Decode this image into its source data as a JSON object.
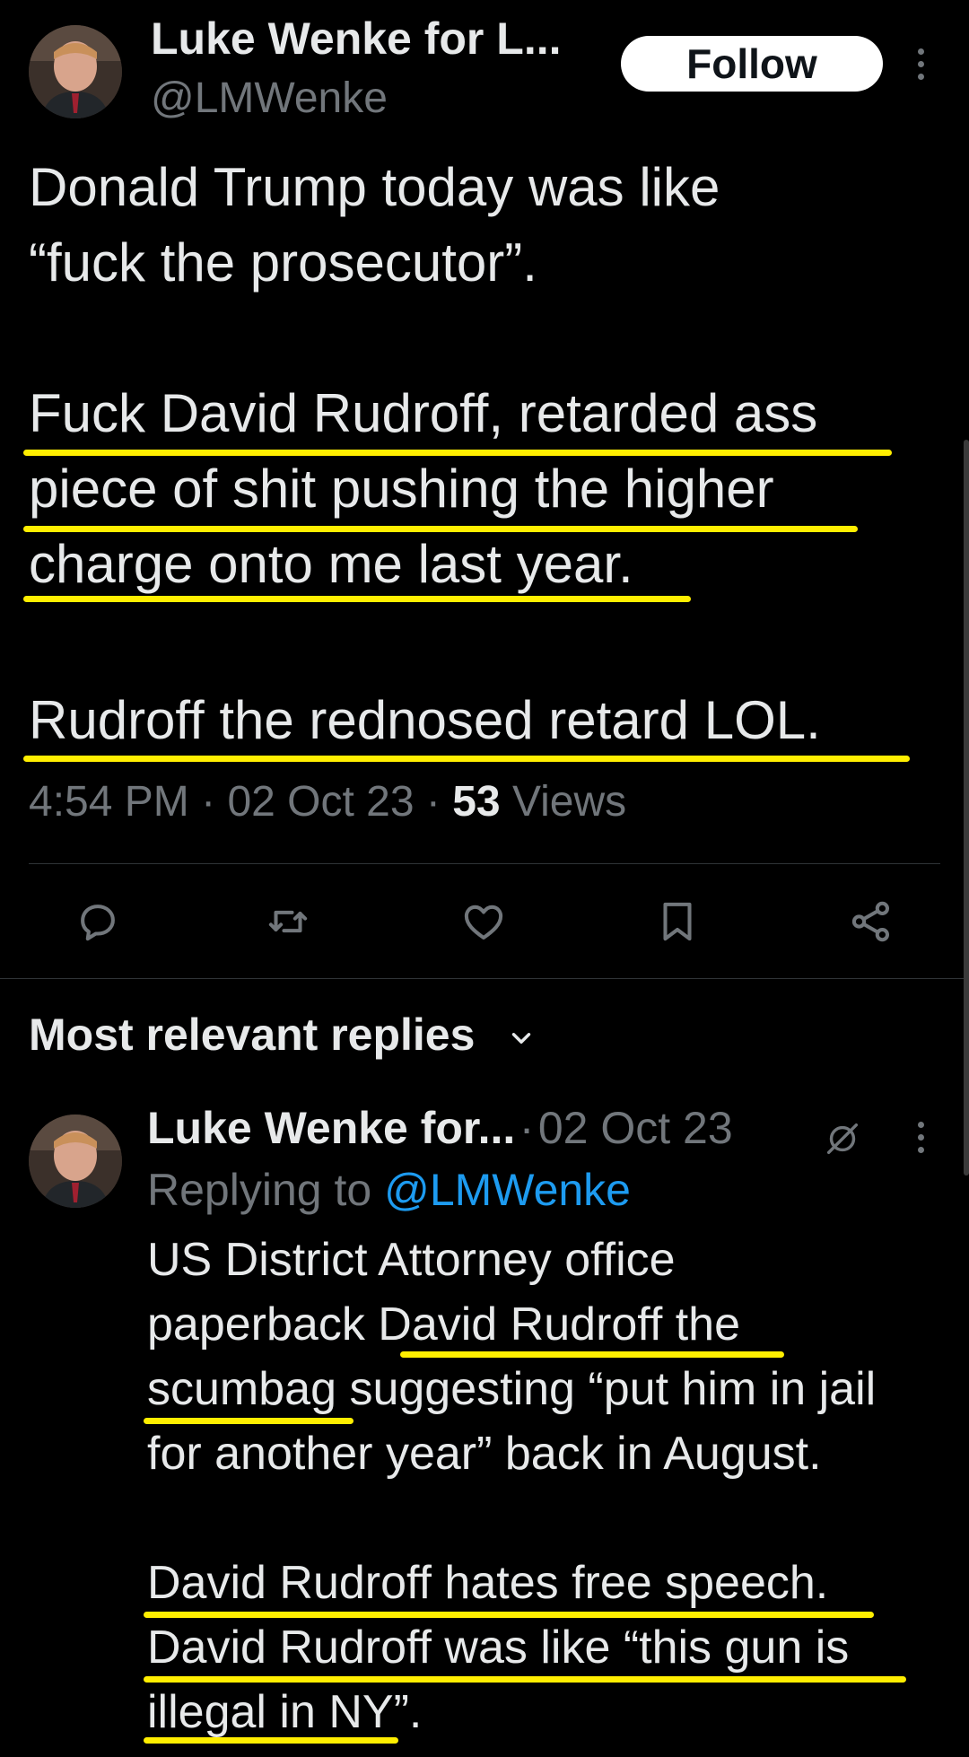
{
  "tweet": {
    "author_name": "Luke Wenke for L...",
    "author_handle": "@LMWenke",
    "follow_label": "Follow",
    "body_lines": [
      "Donald Trump today was like",
      "“fuck the prosecutor”.",
      "Fuck David Rudroff, retarded ass",
      "piece of shit pushing the higher",
      "charge onto me last year.",
      "Rudroff the rednosed retard LOL."
    ],
    "time": "4:54 PM",
    "date": "02 Oct 23",
    "views_count": "53",
    "views_label": "Views",
    "separator": "·"
  },
  "actions": [
    "reply-icon",
    "retweet-icon",
    "like-icon",
    "bookmark-icon",
    "share-icon"
  ],
  "replies": {
    "sort_label": "Most relevant replies"
  },
  "reply": {
    "author_name": "Luke Wenke for...",
    "date": "02 Oct 23",
    "separator": "·",
    "replying_prefix": "Replying to",
    "replying_handle": "@LMWenke",
    "body_lines": [
      "US District Attorney office",
      "paperback David Rudroff the",
      "scumbag suggesting “put him in jail",
      "for another year” back in August.",
      "David Rudroff hates free speech.",
      "David Rudroff was like “this gun is",
      "illegal in NY”."
    ]
  },
  "colors": {
    "background": "#000000",
    "text": "#e7e9ea",
    "secondary": "#71767b",
    "link": "#1d9bf0",
    "highlight": "#ffee00"
  }
}
